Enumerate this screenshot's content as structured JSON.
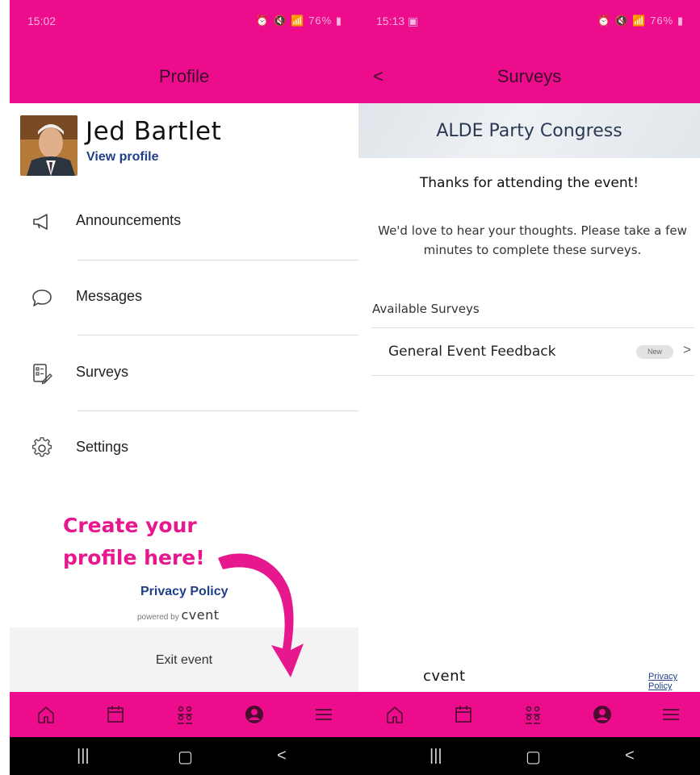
{
  "colors": {
    "brand_pink": "#ec0c8c",
    "link_blue": "#1f3f88",
    "annotation_pink": "#e7178e"
  },
  "left": {
    "status": {
      "time": "15:02",
      "battery": "76%"
    },
    "header": {
      "title": "Profile"
    },
    "profile": {
      "name": "Jed Bartlet",
      "view_profile": "View profile"
    },
    "menu": [
      {
        "label": "Announcements",
        "icon": "megaphone-icon"
      },
      {
        "label": "Messages",
        "icon": "speech-bubble-icon"
      },
      {
        "label": "Surveys",
        "icon": "survey-list-icon"
      },
      {
        "label": "Settings",
        "icon": "gear-icon"
      }
    ],
    "promo_line1": "Create your",
    "promo_line2": "profile here!",
    "privacy": "Privacy Policy",
    "powered_by": "powered by",
    "brand": "cvent",
    "exit": "Exit event"
  },
  "right": {
    "status": {
      "time": "15:13",
      "battery": "76%"
    },
    "header": {
      "title": "Surveys"
    },
    "event_name": "ALDE Party Congress",
    "thanks": "Thanks for attending the event!",
    "intro": "We'd love to hear your thoughts. Please take a few minutes to complete these surveys.",
    "section_label": "Available Surveys",
    "surveys": [
      {
        "label": "General Event Feedback",
        "badge": "New"
      }
    ],
    "brand": "cvent",
    "privacy": "Privacy Policy"
  },
  "bottom_nav": [
    "home-icon",
    "calendar-icon",
    "attendees-icon",
    "profile-icon",
    "menu-icon"
  ],
  "system_nav": [
    "recent-apps-icon",
    "home-button-icon",
    "back-icon"
  ]
}
